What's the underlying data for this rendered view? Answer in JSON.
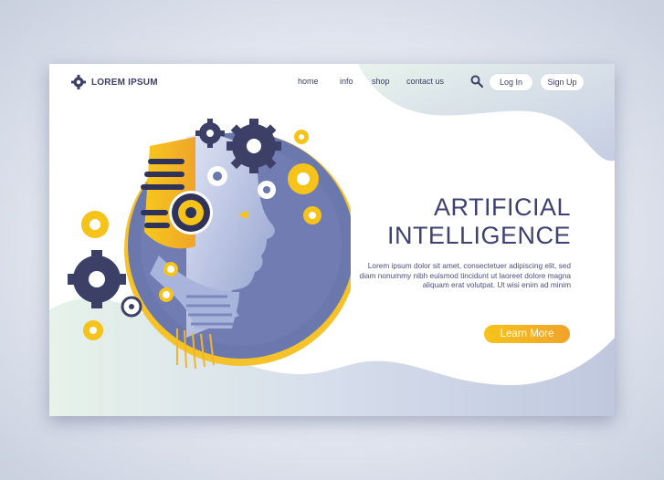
{
  "brand": {
    "name": "LOREM IPSUM",
    "icon": "gear-icon"
  },
  "nav": {
    "items": [
      "home",
      "info",
      "shop",
      "contact us"
    ]
  },
  "header": {
    "search_icon": "search-icon",
    "login_label": "Log In",
    "signup_label": "Sign Up"
  },
  "hero": {
    "title_line1": "ARTIFICIAL",
    "title_line2": "INTELLIGENCE",
    "description": "Lorem ipsum dolor sit amet, consectetuer adipiscing elit, sed diam nonummy nibh euismod tincidunt ut laoreet dolore magna aliquam erat volutpat. Ut wisi enim ad minim",
    "cta_label": "Learn More"
  },
  "colors": {
    "navy": "#3e4270",
    "accent_yellow": "#f6c31b",
    "accent_orange": "#f1a32a",
    "blob_blue": "#c9d2e6",
    "blob_green": "#e3f0ea",
    "circle_blue": "#6b78ad"
  }
}
